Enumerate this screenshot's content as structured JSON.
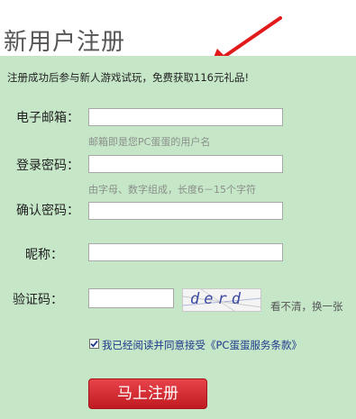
{
  "header": {
    "title": "新用户注册"
  },
  "intro": "注册成功后参与新人游戏试玩，免费获取116元礼品!",
  "fields": {
    "email": {
      "label": "电子邮箱：",
      "value": "",
      "hint": "邮箱即是您PC蛋蛋的用户名"
    },
    "password": {
      "label": "登录密码：",
      "value": "",
      "hint": "由字母、数字组成，长度6－15个字符"
    },
    "confirm": {
      "label": "确认密码：",
      "value": ""
    },
    "nickname": {
      "label": "昵称：",
      "value": ""
    },
    "captcha": {
      "label": "验证码：",
      "value": "",
      "image_text": "derd",
      "refresh_label": "看不清，换一张"
    }
  },
  "agree": {
    "checked": true,
    "label": "我已经阅读并同意接受《PC蛋蛋服务条款》"
  },
  "submit": {
    "label": "马上注册"
  },
  "colors": {
    "form_bg": "#c6e6c8",
    "button": "#d52a31",
    "arrow": "#e11a1a",
    "link": "#1e3a8c"
  }
}
